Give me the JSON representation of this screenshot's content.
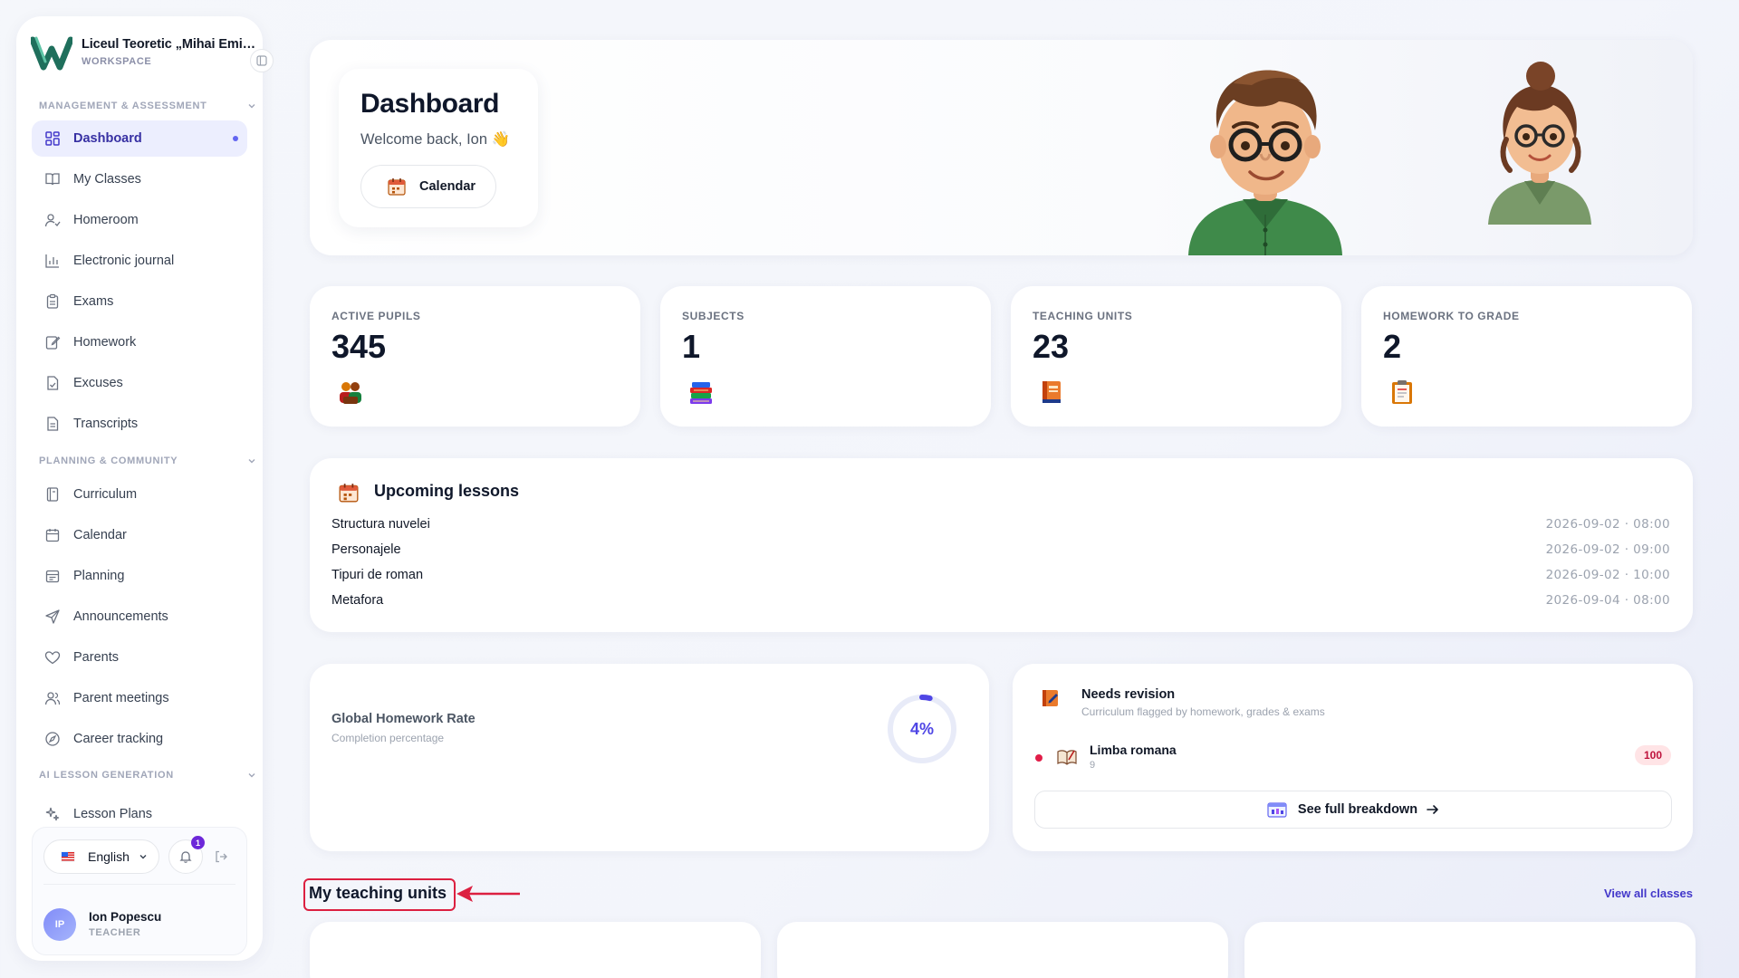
{
  "workspace": {
    "name": "Liceul Teoretic „Mihai Eminescu”",
    "label": "WORKSPACE"
  },
  "sidebar": {
    "sections": [
      {
        "title": "MANAGEMENT & ASSESSMENT"
      },
      {
        "title": "PLANNING & COMMUNITY"
      },
      {
        "title": "AI LESSON GENERATION"
      }
    ],
    "items": [
      {
        "label": "Dashboard",
        "icon": "grid-icon"
      },
      {
        "label": "My Classes",
        "icon": "book-icon"
      },
      {
        "label": "Homeroom",
        "icon": "user-check-icon"
      },
      {
        "label": "Electronic journal",
        "icon": "bar-chart-icon"
      },
      {
        "label": "Exams",
        "icon": "clipboard-icon"
      },
      {
        "label": "Homework",
        "icon": "edit-icon"
      },
      {
        "label": "Excuses",
        "icon": "file-check-icon"
      },
      {
        "label": "Transcripts",
        "icon": "file-text-icon"
      },
      {
        "label": "Curriculum",
        "icon": "notebook-icon"
      },
      {
        "label": "Calendar",
        "icon": "calendar-icon"
      },
      {
        "label": "Planning",
        "icon": "calendar-plan-icon"
      },
      {
        "label": "Announcements",
        "icon": "send-icon"
      },
      {
        "label": "Parents",
        "icon": "heart-icon"
      },
      {
        "label": "Parent meetings",
        "icon": "users-icon"
      },
      {
        "label": "Career tracking",
        "icon": "compass-icon"
      },
      {
        "label": "Lesson Plans",
        "icon": "sparkles-icon"
      }
    ],
    "language": "English",
    "notifications": "1",
    "user": {
      "initials": "IP",
      "name": "Ion Popescu",
      "role": "TEACHER"
    }
  },
  "hero": {
    "title": "Dashboard",
    "welcome": "Welcome back, Ion 👋",
    "calendar_label": "Calendar"
  },
  "stats": [
    {
      "label": "ACTIVE PUPILS",
      "value": "345",
      "icon": "pupils-icon"
    },
    {
      "label": "SUBJECTS",
      "value": "1",
      "icon": "books-icon"
    },
    {
      "label": "TEACHING UNITS",
      "value": "23",
      "icon": "unit-book-icon"
    },
    {
      "label": "HOMEWORK TO GRADE",
      "value": "2",
      "icon": "clipboard-icon"
    }
  ],
  "lessons": {
    "title": "Upcoming lessons",
    "rows": [
      {
        "name": "Structura nuvelei",
        "time": "2026-09-02 · 08:00"
      },
      {
        "name": "Personajele",
        "time": "2026-09-02 · 09:00"
      },
      {
        "name": "Tipuri de roman",
        "time": "2026-09-02 · 10:00"
      },
      {
        "name": "Metafora",
        "time": "2026-09-04 · 08:00"
      }
    ]
  },
  "homework_rate": {
    "title": "Global Homework Rate",
    "subtitle": "Completion percentage",
    "value": 4,
    "display": "4%"
  },
  "revision": {
    "title": "Needs revision",
    "subtitle": "Curriculum flagged by homework, grades & exams",
    "item": {
      "name": "Limba romana",
      "sub": "9",
      "badge": "100"
    },
    "button": "See full breakdown"
  },
  "units": {
    "title": "My teaching units",
    "view_all": "View all classes"
  },
  "colors": {
    "accent": "#6366f1",
    "danger": "#e11d48",
    "link": "#4338ca"
  }
}
